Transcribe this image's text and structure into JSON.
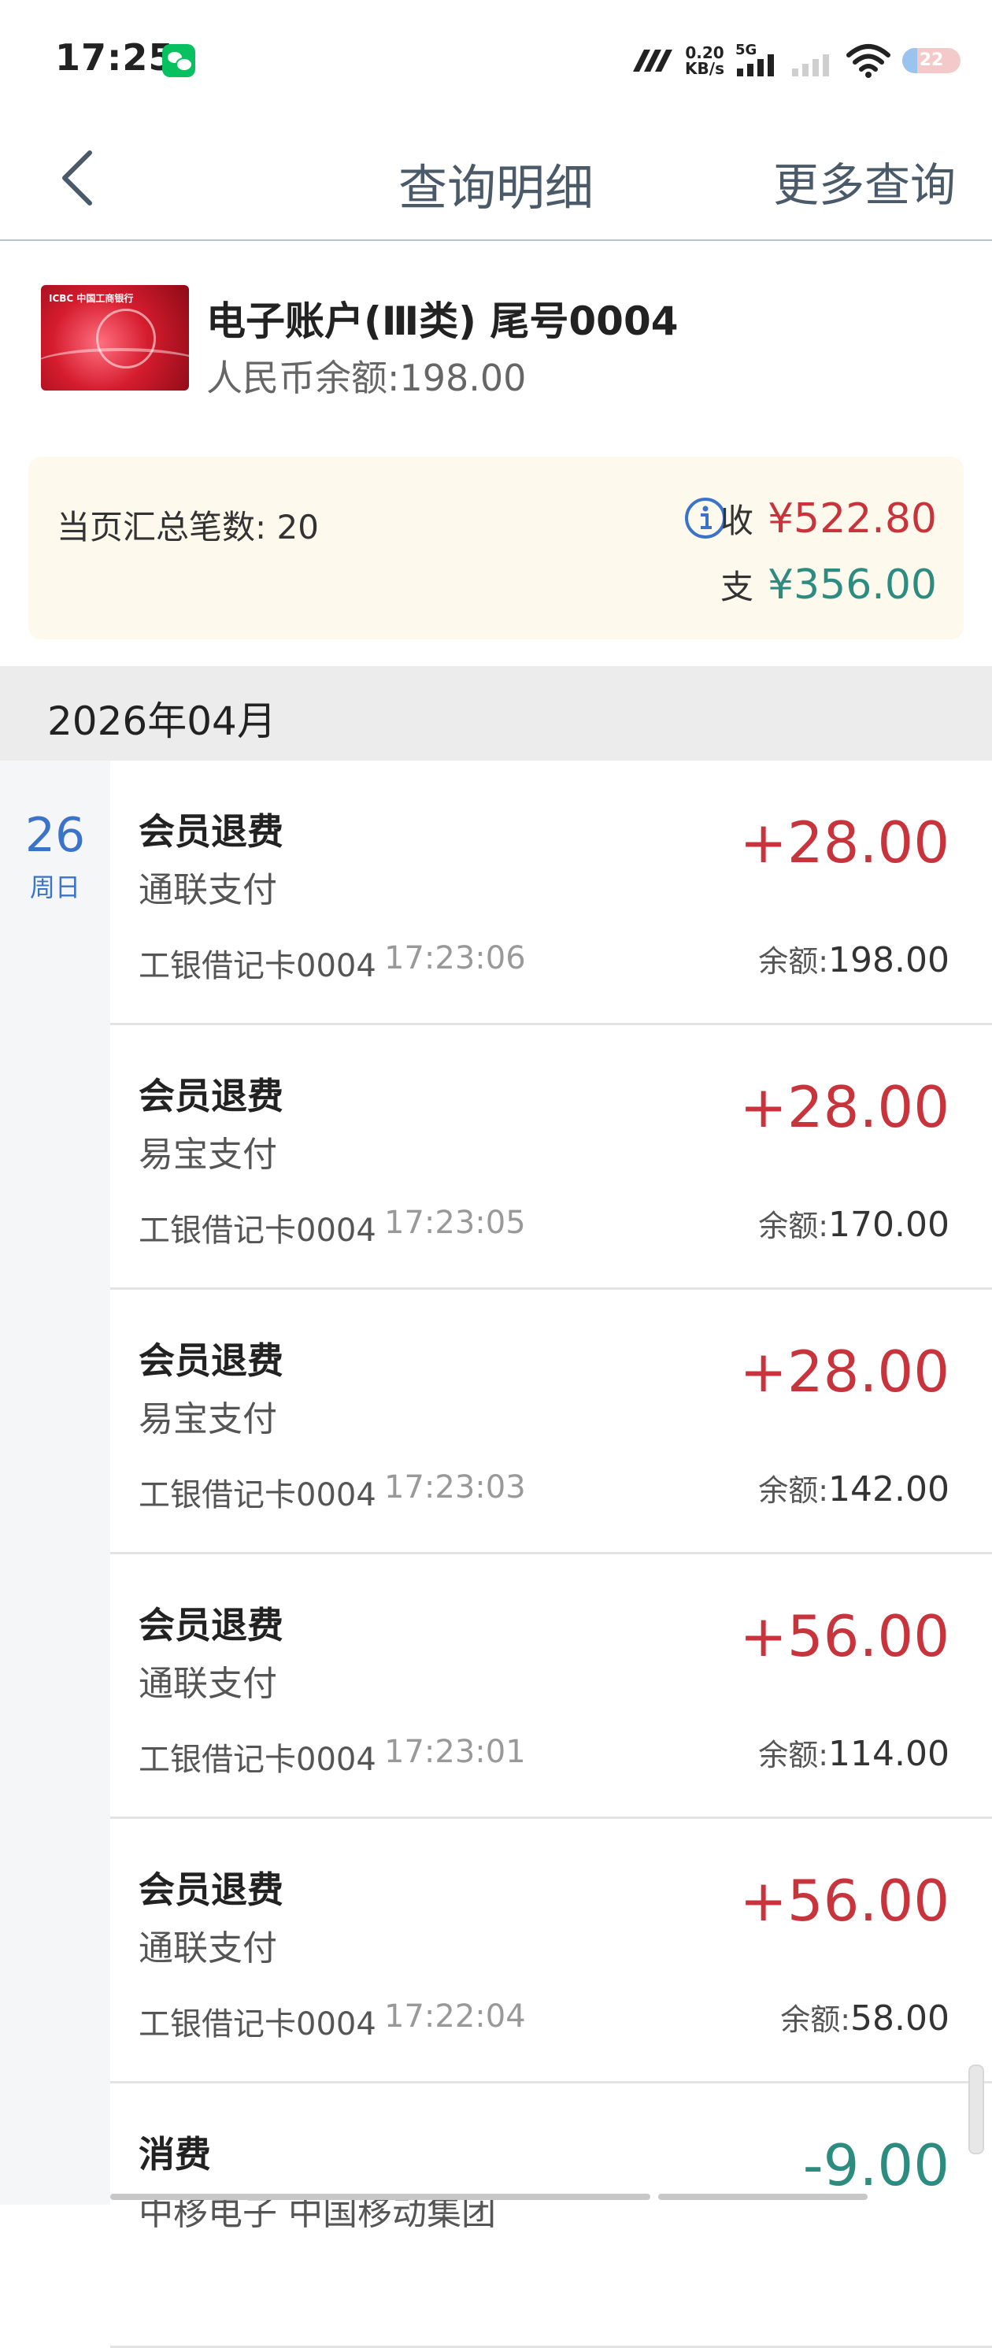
{
  "status_bar": {
    "time": "17:25",
    "net_speed": "0.20",
    "net_unit": "KB/s",
    "network_type": "5G",
    "battery": "22"
  },
  "header": {
    "title": "查询明细",
    "more": "更多查询"
  },
  "account": {
    "name": "电子账户(Ⅲ类)  尾号0004",
    "balance": "人民币余额:198.00"
  },
  "summary": {
    "count_label": "当页汇总笔数: 20",
    "income_label": "收",
    "income": "¥522.80",
    "expense_label": "支",
    "expense": "¥356.00"
  },
  "month": "2026年04月",
  "day": {
    "number": "26",
    "weekday": "周日"
  },
  "transactions": [
    {
      "title": "会员退费",
      "channel": "通联支付",
      "card": "工银借记卡0004",
      "time": "17:23:06",
      "amount": "+28.00",
      "balance_label": "余额:",
      "balance": "198.00"
    },
    {
      "title": "会员退费",
      "channel": "易宝支付",
      "card": "工银借记卡0004",
      "time": "17:23:05",
      "amount": "+28.00",
      "balance_label": "余额:",
      "balance": "170.00"
    },
    {
      "title": "会员退费",
      "channel": "易宝支付",
      "card": "工银借记卡0004",
      "time": "17:23:03",
      "amount": "+28.00",
      "balance_label": "余额:",
      "balance": "142.00"
    },
    {
      "title": "会员退费",
      "channel": "通联支付",
      "card": "工银借记卡0004",
      "time": "17:23:01",
      "amount": "+56.00",
      "balance_label": "余额:",
      "balance": "114.00"
    },
    {
      "title": "会员退费",
      "channel": "通联支付",
      "card": "工银借记卡0004",
      "time": "17:22:04",
      "amount": "+56.00",
      "balance_label": "余额:",
      "balance": "58.00"
    },
    {
      "title": "消费",
      "channel": "中移电子 中国移动集团",
      "card": "",
      "time": "",
      "amount": "-9.00",
      "balance_label": "",
      "balance": ""
    }
  ],
  "colors": {
    "income": "#c8343c",
    "expense": "#2d8c80",
    "accent": "#3b73c9"
  }
}
